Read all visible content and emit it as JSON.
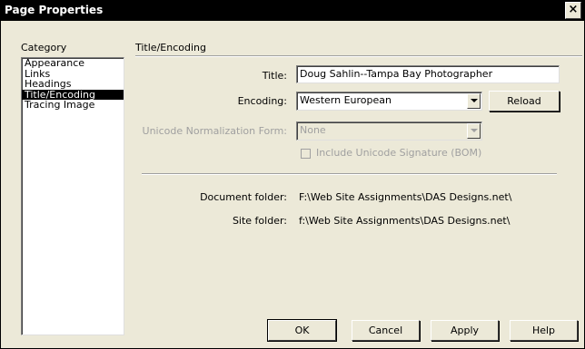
{
  "window": {
    "title": "Page Properties",
    "close_glyph": "×"
  },
  "category": {
    "header": "Category",
    "items": [
      {
        "label": "Appearance",
        "selected": false
      },
      {
        "label": "Links",
        "selected": false
      },
      {
        "label": "Headings",
        "selected": false
      },
      {
        "label": "Title/Encoding",
        "selected": true
      },
      {
        "label": "Tracing Image",
        "selected": false
      }
    ]
  },
  "section": {
    "header": "Title/Encoding"
  },
  "form": {
    "title_label": "Title:",
    "title_value": "Doug Sahlin--Tampa Bay Photographer",
    "encoding_label": "Encoding:",
    "encoding_value": "Western European",
    "reload_label": "Reload",
    "normalization_label": "Unicode Normalization Form:",
    "normalization_value": "None",
    "bom_label": "Include Unicode Signature (BOM)",
    "bom_checked": false,
    "doc_folder_label": "Document folder:",
    "doc_folder_value": "F:\\Web Site Assignments\\DAS Designs.net\\",
    "site_folder_label": "Site folder:",
    "site_folder_value": "f:\\Web Site Assignments\\DAS Designs.net\\"
  },
  "buttons": {
    "ok": "OK",
    "cancel": "Cancel",
    "apply": "Apply",
    "help": "Help"
  }
}
